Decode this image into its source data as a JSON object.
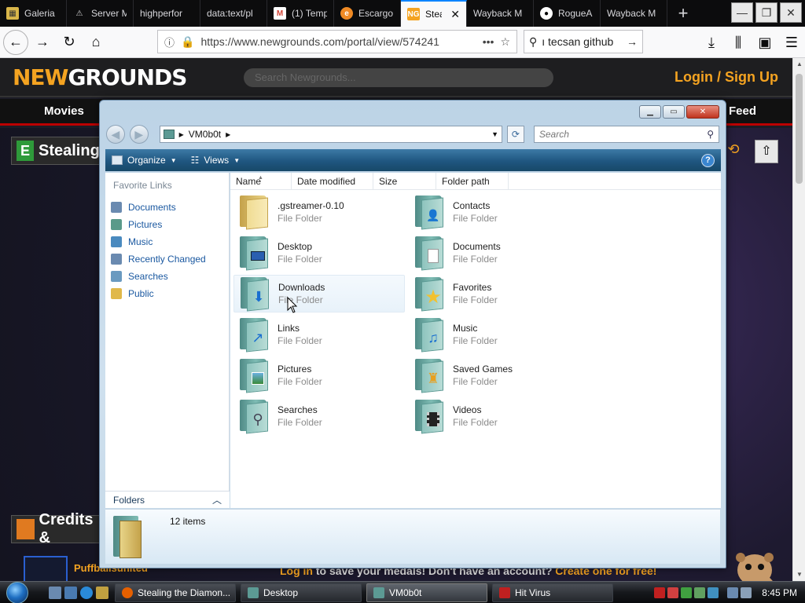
{
  "browser": {
    "tabs": [
      {
        "label": "Galeria",
        "favicon": "galeria-favicon",
        "color": "#d9b64a"
      },
      {
        "label": "Server M",
        "favicon": "warning-icon",
        "color": "#cfcfcf"
      },
      {
        "label": "highperfor",
        "favicon": "",
        "color": ""
      },
      {
        "label": "data:text/pl",
        "favicon": "",
        "color": ""
      },
      {
        "label": "(1) Temp",
        "favicon": "gmail-icon",
        "color": "#d44638"
      },
      {
        "label": "Escargo",
        "favicon": "escargot-icon",
        "color": "#f08a24"
      },
      {
        "label": "Steal",
        "favicon": "newgrounds-icon",
        "color": "#f4a321",
        "active": true
      },
      {
        "label": "Wayback M",
        "favicon": "",
        "color": ""
      },
      {
        "label": "RogueA",
        "favicon": "github-icon",
        "color": "#ffffff"
      },
      {
        "label": "Wayback M",
        "favicon": "",
        "color": ""
      }
    ],
    "new_tab": "+",
    "url": "https://www.newgrounds.com/portal/view/574241",
    "search_value": "ı tecsan github"
  },
  "newgrounds": {
    "logo_new": "NEW",
    "logo_grounds": "GROUNDS",
    "search_placeholder": "Search Newgrounds...",
    "login": "Login / Sign Up",
    "nav_movies": "Movies",
    "nav_feed": "Feed",
    "title_partial": "Stealing",
    "credits_partial": "Credits &",
    "author": "Puffballsunited",
    "medals_prefix": "Log in",
    "medals_middle": " to save your medals! Don't have an account? ",
    "medals_link": "Create one for free!"
  },
  "explorer": {
    "path_segment": "VM0b0t",
    "search_placeholder": "Search",
    "commands": {
      "organize": "Organize",
      "views": "Views"
    },
    "help_label": "?",
    "favorite_links_header": "Favorite Links",
    "favorite_links": [
      {
        "label": "Documents",
        "icon": "documents-icon",
        "color": "#6a8ab0"
      },
      {
        "label": "Pictures",
        "icon": "pictures-icon",
        "color": "#5a9a8a"
      },
      {
        "label": "Music",
        "icon": "music-icon",
        "color": "#4a8abf"
      },
      {
        "label": "Recently Changed",
        "icon": "recent-icon",
        "color": "#6a8ab0"
      },
      {
        "label": "Searches",
        "icon": "searches-icon",
        "color": "#6a9ac0"
      },
      {
        "label": "Public",
        "icon": "public-folder-icon",
        "color": "#e0b84a"
      }
    ],
    "columns": [
      "Name",
      "Date modified",
      "Size",
      "Folder path"
    ],
    "folders_toggle": "Folders",
    "items": [
      {
        "name": ".gstreamer-0.10",
        "type": "File Folder",
        "icon": "plain-folder-icon",
        "style": "yellow"
      },
      {
        "name": "Contacts",
        "type": "File Folder",
        "icon": "contacts-folder-icon"
      },
      {
        "name": "Desktop",
        "type": "File Folder",
        "icon": "desktop-folder-icon"
      },
      {
        "name": "Documents",
        "type": "File Folder",
        "icon": "documents-folder-icon"
      },
      {
        "name": "Downloads",
        "type": "File Folder",
        "icon": "downloads-folder-icon",
        "hover": true
      },
      {
        "name": "Favorites",
        "type": "File Folder",
        "icon": "favorites-folder-icon"
      },
      {
        "name": "Links",
        "type": "File Folder",
        "icon": "links-folder-icon"
      },
      {
        "name": "Music",
        "type": "File Folder",
        "icon": "music-folder-icon"
      },
      {
        "name": "Pictures",
        "type": "File Folder",
        "icon": "pictures-folder-icon"
      },
      {
        "name": "Saved Games",
        "type": "File Folder",
        "icon": "saved-games-folder-icon"
      },
      {
        "name": "Searches",
        "type": "File Folder",
        "icon": "searches-folder-icon"
      },
      {
        "name": "Videos",
        "type": "File Folder",
        "icon": "videos-folder-icon"
      }
    ],
    "item_count": "12 items"
  },
  "taskbar": {
    "buttons": [
      {
        "label": "Stealing the Diamon...",
        "icon": "firefox-icon"
      },
      {
        "label": "Desktop",
        "icon": "folder-icon"
      },
      {
        "label": "VM0b0t",
        "icon": "folder-icon",
        "active": true
      },
      {
        "label": "Hit Virus",
        "icon": "hit-virus-icon"
      }
    ],
    "clock": "8:45 PM"
  }
}
